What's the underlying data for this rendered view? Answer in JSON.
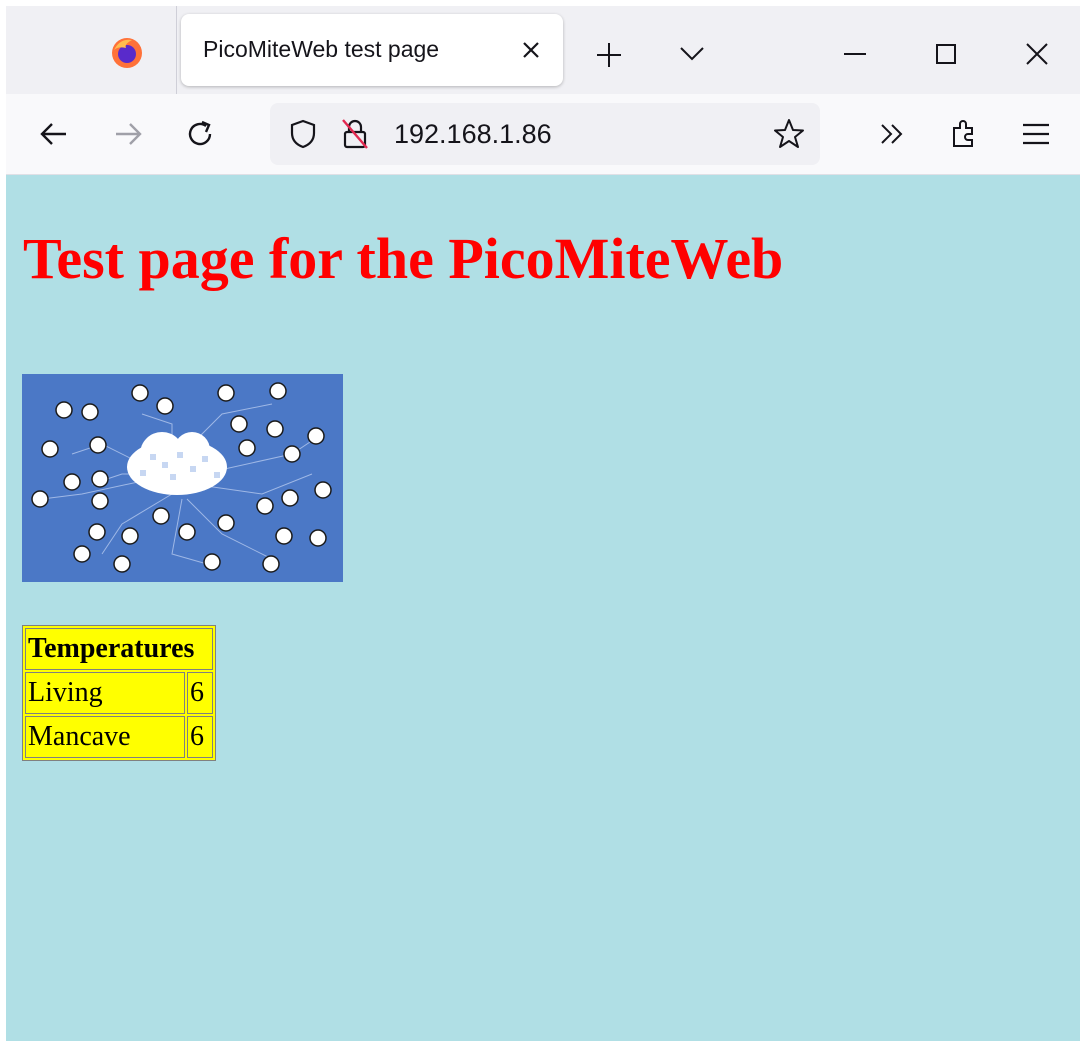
{
  "browser": {
    "tab_title": "PicoMiteWeb test page",
    "url": "192.168.1.86",
    "icons": [
      "firefox-logo-icon",
      "close-icon",
      "plus-icon",
      "chevron-down-icon",
      "minimize-icon",
      "maximize-icon",
      "close-window-icon",
      "back-arrow-icon",
      "forward-arrow-icon",
      "reload-icon",
      "shield-icon",
      "insecure-lock-icon",
      "star-icon",
      "overflow-icon",
      "extensions-icon",
      "menu-icon"
    ]
  },
  "page": {
    "background_color": "#b0dfe5",
    "title": "Test page for the PicoMiteWeb",
    "title_color": "#ff0000",
    "image_alt": "IoT cloud network illustration",
    "table": {
      "header": "Temperatures",
      "background_color": "#ffff00",
      "rows": [
        {
          "label": "Living",
          "value": "6"
        },
        {
          "label": "Mancave",
          "value": "6"
        }
      ]
    }
  }
}
